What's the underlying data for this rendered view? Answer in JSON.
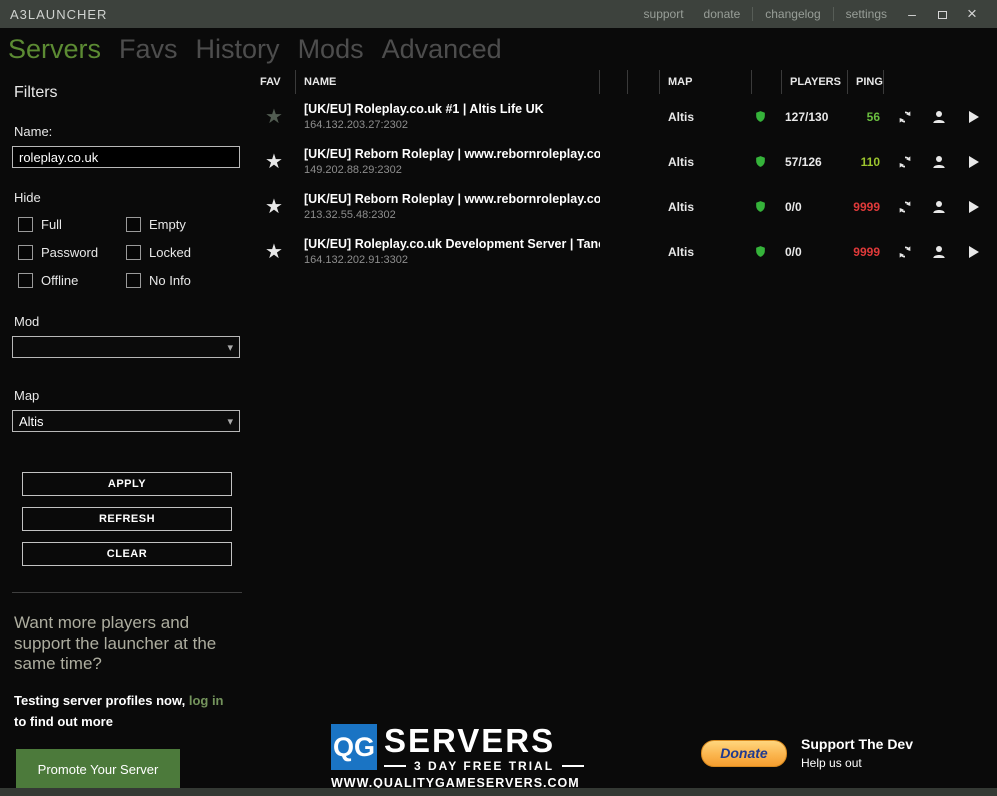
{
  "titlebar": {
    "title": "A3LAUNCHER",
    "links": [
      "support",
      "donate",
      "changelog",
      "settings"
    ],
    "minimize": "–",
    "close": "×"
  },
  "nav": {
    "tabs": [
      {
        "label": "Servers",
        "active": true
      },
      {
        "label": "Favs",
        "active": false
      },
      {
        "label": "History",
        "active": false
      },
      {
        "label": "Mods",
        "active": false
      },
      {
        "label": "Advanced",
        "active": false
      }
    ]
  },
  "filters": {
    "heading": "Filters",
    "name_label": "Name:",
    "name_value": "roleplay.co.uk",
    "hide_label": "Hide",
    "checkboxes": [
      "Full",
      "Empty",
      "Password",
      "Locked",
      "Offline",
      "No Info"
    ],
    "mod_label": "Mod",
    "mod_value": "",
    "map_label": "Map",
    "map_value": "Altis",
    "apply": "APPLY",
    "refresh": "REFRESH",
    "clear": "CLEAR"
  },
  "promo": {
    "headline": "Want more players and support the launcher at the same time?",
    "line_prefix": "Testing server profiles now,",
    "line_link": "log in",
    "line_suffix": "to find out more",
    "button": "Promote Your Server"
  },
  "table": {
    "headers": {
      "fav": "FAV",
      "name": "NAME",
      "map": "MAP",
      "players": "PLAYERS",
      "ping": "PING"
    },
    "rows": [
      {
        "name": "[UK/EU] Roleplay.co.uk #1 | Altis Life UK",
        "address": "164.132.203.27:2302",
        "map": "Altis",
        "players": "127/130",
        "ping": "56"
      },
      {
        "name": "[UK/EU] Reborn Roleplay | www.rebornroleplay.co.u",
        "address": "149.202.88.29:2302",
        "map": "Altis",
        "players": "57/126",
        "ping": "110"
      },
      {
        "name": "[UK/EU] Reborn Roleplay | www.rebornroleplay.co.u",
        "address": "213.32.55.48:2302",
        "map": "Altis",
        "players": "0/0",
        "ping": "9999"
      },
      {
        "name": "[UK/EU] Roleplay.co.uk Development Server | Tanoa",
        "address": "164.132.202.91:3302",
        "map": "Altis",
        "players": "0/0",
        "ping": "9999"
      }
    ]
  },
  "footer": {
    "qg_logo": "QG",
    "qg_brand": "SERVERS",
    "qg_trial": "3 DAY FREE TRIAL",
    "qg_url": "WWW.QUALITYGAMESERVERS.COM",
    "donate_button": "Donate",
    "donate_title": "Support The Dev",
    "donate_subtitle": "Help us out"
  },
  "colors": {
    "titlebar_bg": "#3d423d",
    "accent_green": "#5c8b33",
    "button_green": "#4c7a3b",
    "ping_good": "#6abf3f",
    "ping_mid": "#9dc62e",
    "ping_bad": "#e03a3a",
    "shield_green": "#35b33a",
    "qg_blue": "#1a74c4",
    "donate_text_blue": "#203a8f"
  }
}
